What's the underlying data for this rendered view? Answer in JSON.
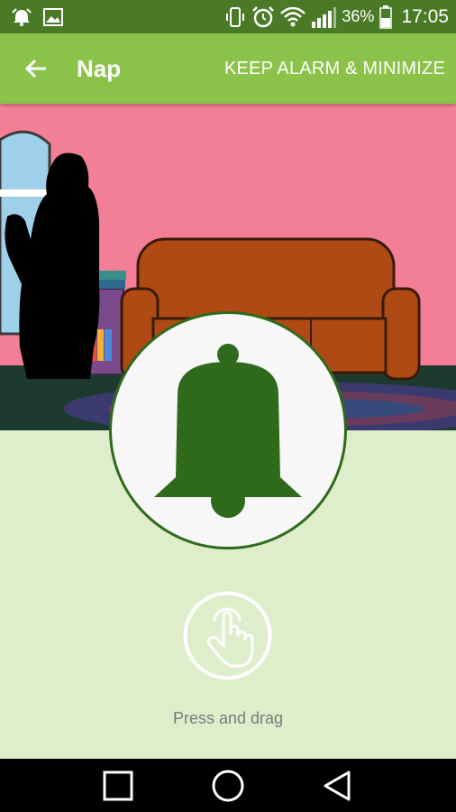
{
  "status_bar": {
    "battery_percent": "36%",
    "time": "17:05",
    "icons": [
      "alarm-notification-icon",
      "image-icon",
      "vibrate-icon",
      "alarm-clock-icon",
      "wifi-icon",
      "signal-icon",
      "battery-icon"
    ]
  },
  "app_bar": {
    "title": "Nap",
    "back_icon": "arrow-back-icon",
    "action_label": "KEEP ALARM & MINIMIZE"
  },
  "alarm": {
    "bell_icon": "bell-icon",
    "hand_icon": "touch-hand-icon",
    "hint": "Press and drag"
  },
  "navigation_bar": {
    "icons": [
      "recent-apps-icon",
      "home-icon",
      "back-icon"
    ]
  },
  "colors": {
    "status_bar": "#4a7a25",
    "app_bar": "#8bc34a",
    "scene_wall": "#f27f96",
    "background": "#dfeeca",
    "bell": "#2f6a1c",
    "sofa": "#b04a14"
  }
}
